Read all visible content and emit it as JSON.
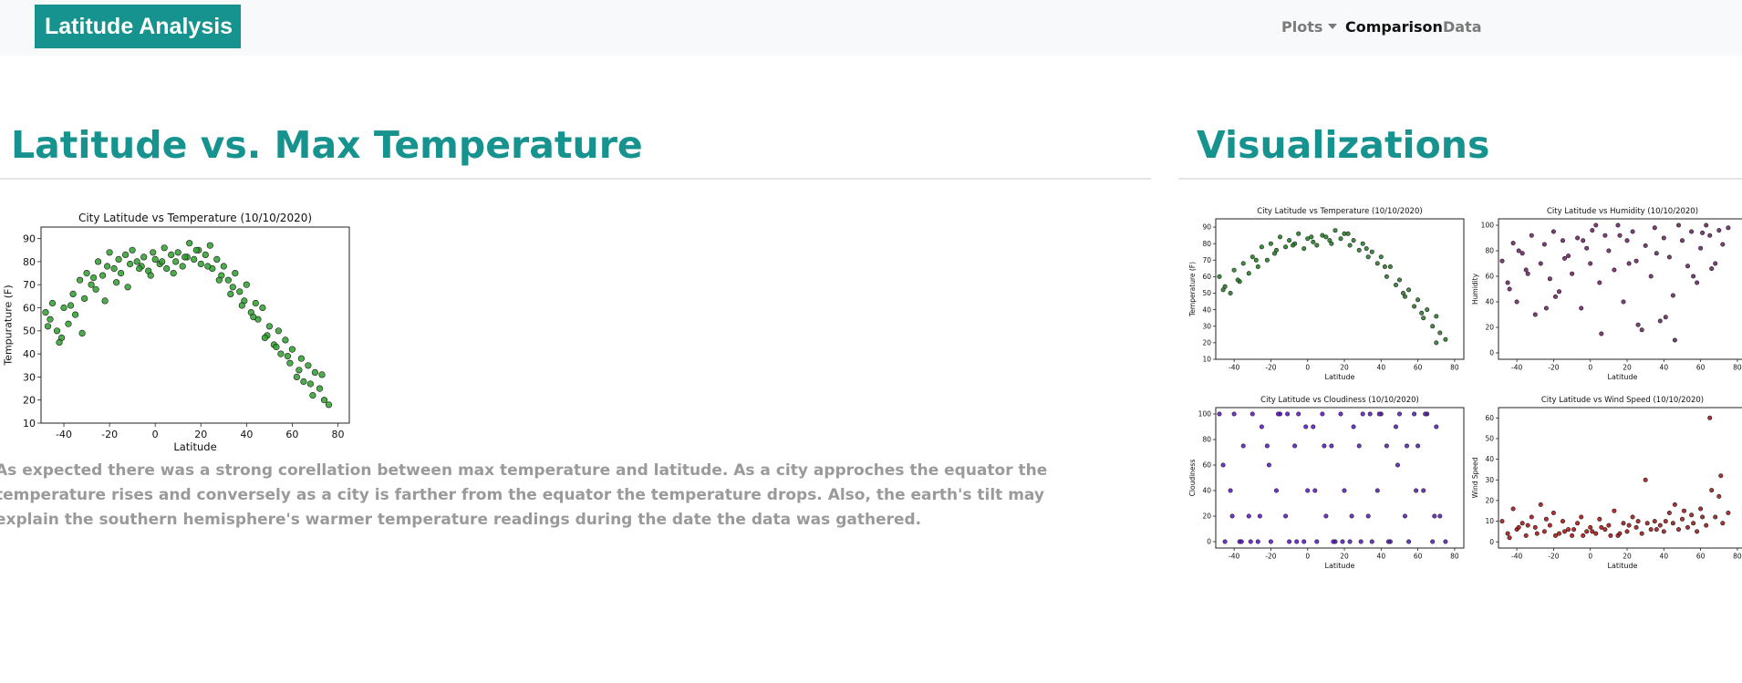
{
  "navbar": {
    "brand": "Latitude Analysis",
    "items": [
      {
        "label": "Plots",
        "dropdown": true
      },
      {
        "label": "Comparison",
        "active": true
      },
      {
        "label": "Data"
      }
    ]
  },
  "main": {
    "heading": "Latitude vs. Max Temperature",
    "paragraph": "As expected there was a strong corellation between max temperature and latitude. As a city approches the equator the temperature rises and conversely as a city is farther from the equator the temperature drops. Also, the earth's tilt may explain the southern hemisphere's warmer temperature readings during the date the data was gathered."
  },
  "sidebar": {
    "heading": "Visualizations"
  },
  "colors": {
    "brand": "#17938f",
    "temperature": "#2ca02c",
    "temperature_small": "#1e7a1e",
    "humidity": "#6b1d63",
    "cloudiness": "#5b14c8",
    "wind": "#a50e0e"
  },
  "chart_data": [
    {
      "id": "main-temp",
      "type": "scatter",
      "title": "City Latitude vs Temperature (10/10/2020)",
      "xlabel": "Latitude",
      "ylabel": "Tempurature (F)",
      "xlim": [
        -50,
        85
      ],
      "ylim": [
        10,
        95
      ],
      "xticks": [
        -40,
        -20,
        0,
        20,
        40,
        60,
        80
      ],
      "yticks": [
        10,
        20,
        30,
        40,
        50,
        60,
        70,
        80,
        90
      ],
      "color": "#2ca02c",
      "x": [
        -48,
        -46,
        -45,
        -43,
        -41,
        -40,
        -38,
        -36,
        -35,
        -33,
        -31,
        -30,
        -28,
        -26,
        -25,
        -23,
        -21,
        -20,
        -18,
        -16,
        -15,
        -13,
        -11,
        -10,
        -8,
        -6,
        -5,
        -3,
        -1,
        0,
        2,
        4,
        5,
        7,
        9,
        10,
        12,
        14,
        15,
        17,
        19,
        20,
        22,
        24,
        25,
        27,
        29,
        30,
        32,
        34,
        35,
        37,
        39,
        40,
        42,
        44,
        45,
        47,
        49,
        50,
        52,
        54,
        55,
        57,
        59,
        60,
        62,
        64,
        65,
        67,
        69,
        70,
        72,
        74,
        76,
        -47,
        -42,
        -37,
        -32,
        -27,
        -22,
        -17,
        -12,
        -7,
        -2,
        3,
        8,
        13,
        18,
        23,
        28,
        33,
        38,
        43,
        48,
        53,
        58,
        63,
        68,
        73
      ],
      "y": [
        58,
        55,
        62,
        50,
        47,
        60,
        53,
        66,
        57,
        72,
        64,
        75,
        70,
        68,
        80,
        74,
        78,
        84,
        77,
        81,
        75,
        83,
        79,
        85,
        80,
        78,
        82,
        76,
        84,
        81,
        79,
        86,
        77,
        83,
        80,
        84,
        78,
        82,
        88,
        81,
        85,
        79,
        83,
        87,
        77,
        81,
        74,
        78,
        72,
        69,
        75,
        67,
        63,
        70,
        58,
        62,
        55,
        60,
        48,
        52,
        44,
        50,
        40,
        46,
        36,
        42,
        30,
        38,
        28,
        35,
        22,
        32,
        25,
        20,
        18,
        52,
        45,
        61,
        49,
        73,
        63,
        71,
        69,
        77,
        74,
        80,
        75,
        82,
        85,
        78,
        72,
        66,
        61,
        56,
        47,
        43,
        39,
        33,
        27,
        31
      ]
    },
    {
      "id": "small-temp",
      "type": "scatter",
      "title": "City Latitude vs Temperature (10/10/2020)",
      "xlabel": "Latitude",
      "ylabel": "Temperature (F)",
      "xlim": [
        -50,
        85
      ],
      "ylim": [
        10,
        95
      ],
      "xticks": [
        -40,
        -20,
        0,
        20,
        40,
        60,
        80
      ],
      "yticks": [
        10,
        20,
        30,
        40,
        50,
        60,
        70,
        80,
        90
      ],
      "color": "#1e7a1e",
      "x": [
        -48,
        -45,
        -42,
        -40,
        -37,
        -35,
        -32,
        -30,
        -27,
        -25,
        -22,
        -20,
        -17,
        -15,
        -12,
        -10,
        -7,
        -5,
        -2,
        0,
        3,
        5,
        8,
        10,
        13,
        15,
        18,
        20,
        23,
        25,
        28,
        30,
        33,
        35,
        38,
        40,
        43,
        45,
        48,
        50,
        53,
        55,
        58,
        60,
        63,
        65,
        68,
        70,
        72,
        75,
        -46,
        -38,
        -28,
        -18,
        -8,
        2,
        12,
        22,
        32,
        42,
        52,
        62,
        70
      ],
      "y": [
        60,
        54,
        50,
        64,
        57,
        68,
        62,
        72,
        66,
        78,
        70,
        80,
        76,
        84,
        78,
        82,
        80,
        86,
        77,
        83,
        81,
        79,
        85,
        84,
        80,
        88,
        83,
        86,
        79,
        82,
        76,
        80,
        72,
        75,
        68,
        72,
        60,
        66,
        55,
        58,
        48,
        52,
        42,
        46,
        35,
        40,
        30,
        36,
        26,
        22,
        52,
        58,
        70,
        74,
        79,
        84,
        82,
        86,
        77,
        66,
        50,
        38,
        20
      ]
    },
    {
      "id": "small-humidity",
      "type": "scatter",
      "title": "City Latitude vs Humidity (10/10/2020)",
      "xlabel": "Latitude",
      "ylabel": "Humidity",
      "xlim": [
        -50,
        85
      ],
      "ylim": [
        -5,
        105
      ],
      "xticks": [
        -40,
        -20,
        0,
        20,
        40,
        60,
        80
      ],
      "yticks": [
        0,
        20,
        40,
        60,
        80,
        100
      ],
      "color": "#6b1d63",
      "x": [
        -48,
        -45,
        -42,
        -40,
        -37,
        -35,
        -32,
        -30,
        -27,
        -25,
        -22,
        -20,
        -17,
        -15,
        -12,
        -10,
        -7,
        -5,
        -2,
        0,
        3,
        5,
        8,
        10,
        13,
        15,
        18,
        20,
        23,
        25,
        28,
        30,
        33,
        35,
        38,
        40,
        43,
        45,
        48,
        50,
        53,
        55,
        58,
        60,
        63,
        65,
        68,
        70,
        72,
        75,
        -44,
        -34,
        -24,
        -14,
        -4,
        6,
        16,
        26,
        36,
        46,
        56,
        66,
        -39,
        -19,
        1,
        21,
        41,
        61
      ],
      "y": [
        72,
        55,
        86,
        40,
        78,
        65,
        92,
        30,
        70,
        85,
        58,
        95,
        48,
        88,
        76,
        62,
        90,
        35,
        82,
        70,
        100,
        55,
        92,
        80,
        65,
        100,
        40,
        88,
        95,
        72,
        18,
        84,
        60,
        98,
        25,
        90,
        75,
        45,
        100,
        88,
        68,
        95,
        55,
        82,
        100,
        92,
        70,
        96,
        85,
        98,
        50,
        62,
        35,
        74,
        88,
        15,
        92,
        22,
        78,
        10,
        60,
        66,
        80,
        44,
        96,
        70,
        28,
        94
      ]
    },
    {
      "id": "small-cloudiness",
      "type": "scatter",
      "title": "City Latitude vs Cloudiness (10/10/2020)",
      "xlabel": "Latitude",
      "ylabel": "Cloudiness",
      "xlim": [
        -50,
        85
      ],
      "ylim": [
        -5,
        105
      ],
      "xticks": [
        -40,
        -20,
        0,
        20,
        40,
        60,
        80
      ],
      "yticks": [
        0,
        20,
        40,
        60,
        80,
        100
      ],
      "color": "#5b14c8",
      "x": [
        -48,
        -45,
        -42,
        -40,
        -37,
        -35,
        -32,
        -30,
        -27,
        -25,
        -22,
        -20,
        -17,
        -15,
        -12,
        -10,
        -7,
        -5,
        -2,
        0,
        3,
        5,
        8,
        10,
        13,
        15,
        18,
        20,
        23,
        25,
        28,
        30,
        33,
        35,
        38,
        40,
        43,
        45,
        48,
        50,
        53,
        55,
        58,
        60,
        63,
        65,
        68,
        70,
        72,
        75,
        -46,
        -36,
        -26,
        -16,
        -6,
        4,
        14,
        24,
        34,
        44,
        54,
        64,
        -41,
        -21,
        -1,
        19,
        39,
        59,
        69,
        -31,
        -11,
        9,
        29,
        49
      ],
      "y": [
        100,
        0,
        40,
        100,
        0,
        75,
        20,
        100,
        0,
        90,
        75,
        0,
        40,
        100,
        20,
        0,
        75,
        100,
        0,
        40,
        90,
        0,
        100,
        20,
        75,
        0,
        100,
        40,
        0,
        90,
        75,
        100,
        20,
        0,
        40,
        100,
        75,
        0,
        90,
        100,
        20,
        0,
        100,
        75,
        40,
        100,
        0,
        90,
        20,
        0,
        60,
        0,
        20,
        100,
        0,
        40,
        0,
        20,
        100,
        0,
        75,
        100,
        20,
        60,
        90,
        0,
        100,
        40,
        20,
        0,
        100,
        75,
        0,
        60
      ]
    },
    {
      "id": "small-wind",
      "type": "scatter",
      "title": "City Latitude vs Wind Speed (10/10/2020)",
      "xlabel": "Latitude",
      "ylabel": "Wind Speed",
      "xlim": [
        -50,
        85
      ],
      "ylim": [
        -3,
        65
      ],
      "xticks": [
        -40,
        -20,
        0,
        20,
        40,
        60,
        80
      ],
      "yticks": [
        0,
        10,
        20,
        30,
        40,
        50,
        60
      ],
      "color": "#a50e0e",
      "x": [
        -48,
        -45,
        -42,
        -40,
        -37,
        -35,
        -32,
        -30,
        -27,
        -25,
        -22,
        -20,
        -17,
        -15,
        -12,
        -10,
        -7,
        -5,
        -2,
        0,
        3,
        5,
        8,
        10,
        13,
        15,
        18,
        20,
        23,
        25,
        28,
        30,
        33,
        35,
        38,
        40,
        43,
        45,
        48,
        50,
        53,
        55,
        58,
        60,
        63,
        65,
        68,
        70,
        72,
        75,
        -44,
        -34,
        -24,
        -14,
        -4,
        6,
        16,
        26,
        36,
        46,
        56,
        66,
        -39,
        -19,
        1,
        21,
        41,
        61,
        71,
        -29,
        -9,
        11,
        31,
        51
      ],
      "y": [
        10,
        4,
        16,
        6,
        9,
        3,
        12,
        7,
        18,
        5,
        8,
        14,
        4,
        10,
        6,
        3,
        9,
        12,
        5,
        7,
        4,
        11,
        6,
        8,
        15,
        3,
        9,
        5,
        12,
        7,
        4,
        30,
        6,
        10,
        8,
        5,
        14,
        9,
        6,
        11,
        7,
        13,
        5,
        16,
        8,
        60,
        12,
        22,
        9,
        14,
        2,
        8,
        11,
        5,
        3,
        7,
        4,
        10,
        6,
        18,
        9,
        25,
        7,
        3,
        5,
        8,
        10,
        12,
        32,
        4,
        6,
        3,
        9,
        15
      ]
    }
  ]
}
